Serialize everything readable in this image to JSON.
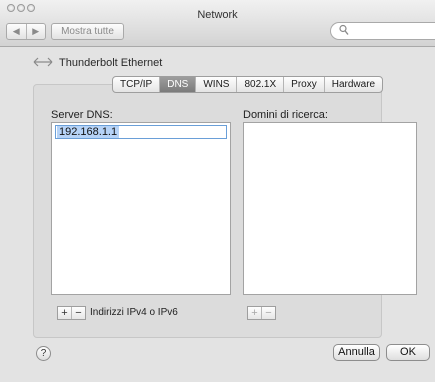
{
  "window": {
    "title": "Network"
  },
  "toolbar": {
    "back_icon": "chevron-left-icon",
    "forward_icon": "chevron-right-icon",
    "show_all_label": "Mostra tutte",
    "search_placeholder": "",
    "search_icon": "magnifier-icon"
  },
  "service": {
    "icon": "thunderbolt-arrows-icon",
    "name": "Thunderbolt Ethernet"
  },
  "tabs": [
    {
      "label": "TCP/IP",
      "active": false
    },
    {
      "label": "DNS",
      "active": true
    },
    {
      "label": "WINS",
      "active": false
    },
    {
      "label": "802.1X",
      "active": false
    },
    {
      "label": "Proxy",
      "active": false
    },
    {
      "label": "Hardware",
      "active": false
    }
  ],
  "dns": {
    "label": "Server DNS:",
    "entries": [
      "192.168.1.1"
    ],
    "add_label": "+",
    "remove_label": "−",
    "note": "Indirizzi IPv4 o IPv6"
  },
  "search_domains": {
    "label": "Domini di ricerca:",
    "entries": [],
    "add_label": "+",
    "remove_label": "−"
  },
  "footer": {
    "help_label": "?",
    "cancel_label": "Annulla",
    "ok_label": "OK"
  }
}
